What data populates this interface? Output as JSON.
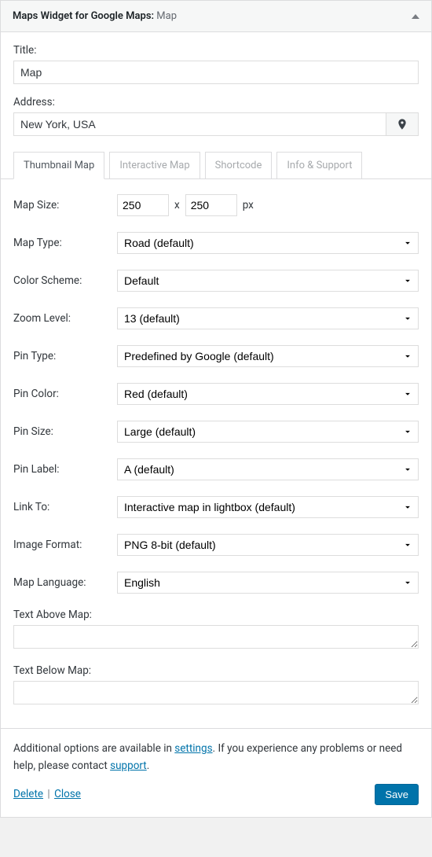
{
  "header": {
    "title": "Maps Widget for Google Maps:",
    "subtitle": "Map"
  },
  "fields": {
    "title": {
      "label": "Title:",
      "value": "Map"
    },
    "address": {
      "label": "Address:",
      "value": "New York, USA"
    }
  },
  "tabs": [
    {
      "label": "Thumbnail Map",
      "active": true
    },
    {
      "label": "Interactive Map",
      "active": false
    },
    {
      "label": "Shortcode",
      "active": false
    },
    {
      "label": "Info & Support",
      "active": false
    }
  ],
  "thumbnail": {
    "mapSize": {
      "label": "Map Size:",
      "width": "250",
      "height": "250",
      "sep": "x",
      "unit": "px"
    },
    "mapType": {
      "label": "Map Type:",
      "value": "Road (default)"
    },
    "colorScheme": {
      "label": "Color Scheme:",
      "value": "Default"
    },
    "zoomLevel": {
      "label": "Zoom Level:",
      "value": "13 (default)"
    },
    "pinType": {
      "label": "Pin Type:",
      "value": "Predefined by Google (default)"
    },
    "pinColor": {
      "label": "Pin Color:",
      "value": "Red (default)"
    },
    "pinSize": {
      "label": "Pin Size:",
      "value": "Large (default)"
    },
    "pinLabel": {
      "label": "Pin Label:",
      "value": "A (default)"
    },
    "linkTo": {
      "label": "Link To:",
      "value": "Interactive map in lightbox (default)"
    },
    "imageFormat": {
      "label": "Image Format:",
      "value": "PNG 8-bit (default)"
    },
    "mapLanguage": {
      "label": "Map Language:",
      "value": "English"
    },
    "textAbove": {
      "label": "Text Above Map:",
      "value": ""
    },
    "textBelow": {
      "label": "Text Below Map:",
      "value": ""
    }
  },
  "footer": {
    "text1": "Additional options are available in ",
    "settingsLink": "settings",
    "text2": ". If you experience any problems or need help, please contact ",
    "supportLink": "support",
    "text3": ".",
    "delete": "Delete",
    "close": "Close",
    "save": "Save"
  }
}
